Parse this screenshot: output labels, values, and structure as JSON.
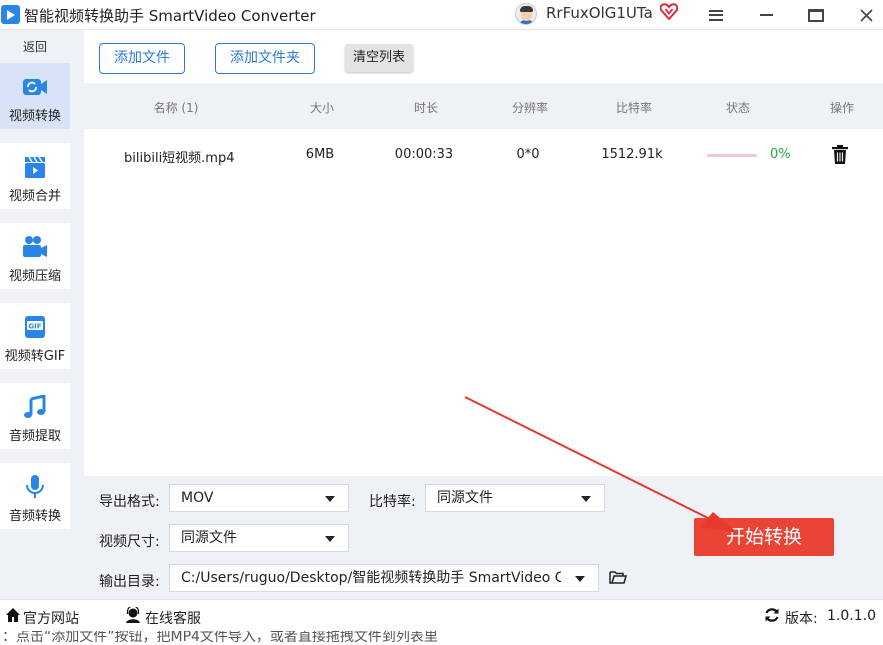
{
  "window": {
    "title": "智能视频转换助手 SmartVideo Converter",
    "user_name": "RrFuxOlG1UTa",
    "vip_icon": "heart-vip-icon",
    "controls": [
      "menu-icon",
      "minimize-icon",
      "maximize-icon",
      "close-icon"
    ]
  },
  "sidebar": {
    "back_label": "返回",
    "items": [
      {
        "label": "视频转换",
        "icon": "video-convert-icon",
        "active": true
      },
      {
        "label": "视频合并",
        "icon": "clapperboard-icon",
        "active": false
      },
      {
        "label": "视频压缩",
        "icon": "video-camera-icon",
        "active": false
      },
      {
        "label": "视频转GIF",
        "icon": "gif-icon",
        "active": false
      },
      {
        "label": "音频提取",
        "icon": "music-note-icon",
        "active": false
      },
      {
        "label": "音频转换",
        "icon": "microphone-icon",
        "active": false
      }
    ]
  },
  "toolbar": {
    "add_file_label": "添加文件",
    "add_folder_label": "添加文件夹",
    "clear_list_label": "清空列表"
  },
  "table": {
    "headers": [
      "名称 (1)",
      "大小",
      "时长",
      "分辨率",
      "比特率",
      "状态",
      "操作"
    ],
    "rows": [
      {
        "name": "bilibili短视频.mp4",
        "size": "6MB",
        "duration": "00:00:33",
        "resolution": "0*0",
        "bitrate": "1512.91k",
        "progress_percent": 0,
        "status": "0%",
        "action_icon": "trash-icon"
      }
    ]
  },
  "settings": {
    "format_label": "导出格式:",
    "format_value": "MOV",
    "bitrate_label": "比特率:",
    "bitrate_value": "同源文件",
    "size_label": "视频尺寸:",
    "size_value": "同源文件",
    "output_label": "输出目录:",
    "output_value": "C:/Users/ruguo/Desktop/智能视频转换助手 SmartVideo Co",
    "start_label": "开始转换"
  },
  "footer": {
    "website_label": "官方网站",
    "service_label": "在线客服",
    "version_label": "版本:",
    "version_value": "1.0.1.0"
  },
  "hint": "：点击“添加文件”按钮，把MP4文件导入，或者直接拖拽文件到列表里",
  "colors": {
    "accent": "#2a7bd6",
    "start_button": "#ea4436",
    "status_green": "#2aa44a",
    "annotation_arrow": "#e8392f",
    "sidebar_bg": "#eef1f6",
    "active_nav": "#d9e3f7"
  }
}
